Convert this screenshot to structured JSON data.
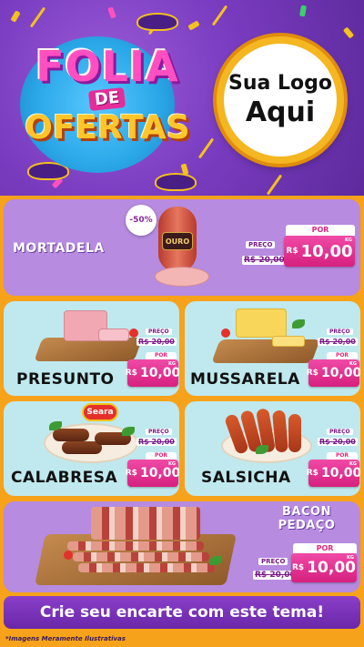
{
  "header": {
    "title_line1": "FOLIA",
    "title_line2": "DE",
    "title_line3": "OFERTAS",
    "logo_line1": "Sua Logo",
    "logo_line2": "Aqui"
  },
  "labels": {
    "preco": "PREÇO",
    "por": "POR",
    "currency": "R$",
    "unit": "KG"
  },
  "products": {
    "mortadela": {
      "name": "MORTADELA",
      "discount": "-50%",
      "old_price": "20,00",
      "new_price": "10,00",
      "brand": "OURO"
    },
    "presunto": {
      "name": "PRESUNTO",
      "old_price": "20,00",
      "new_price": "10,00"
    },
    "mussarela": {
      "name": "MUSSARELA",
      "old_price": "20,00",
      "new_price": "10,00"
    },
    "calabresa": {
      "name": "CALABRESA",
      "old_price": "20,00",
      "new_price": "10,00",
      "brand": "Seara"
    },
    "salsicha": {
      "name": "SALSICHA",
      "old_price": "20,00",
      "new_price": "10,00"
    },
    "bacon": {
      "name_line1": "BACON",
      "name_line2": "PEDAÇO",
      "old_price": "20,00",
      "new_price": "10,00"
    }
  },
  "footer": {
    "cta": "Crie seu encarte com este tema!",
    "disclaimer": "*Imagens Meramente Ilustrativas"
  },
  "colors": {
    "header_purple": "#7a3cc0",
    "background_orange": "#f7a21b",
    "card_lilac": "#b68be0",
    "card_mint": "#bfe9ee",
    "price_pink": "#e0287f"
  }
}
